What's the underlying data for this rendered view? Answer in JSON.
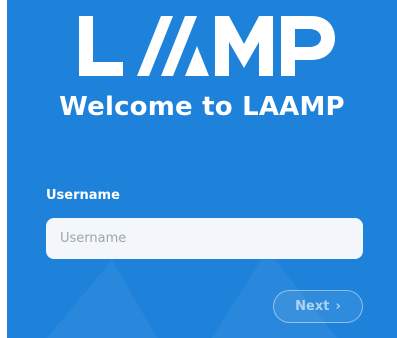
{
  "brand": {
    "logo_text": "LAMP",
    "welcome_title": "Welcome to LAAMP"
  },
  "form": {
    "username_label": "Username",
    "username_placeholder": "Username",
    "username_value": "",
    "next_label": "Next",
    "next_icon": "chevron-right-icon"
  },
  "colors": {
    "background": "#1e82da",
    "input_bg": "#f3f7fb",
    "text": "#ffffff"
  }
}
